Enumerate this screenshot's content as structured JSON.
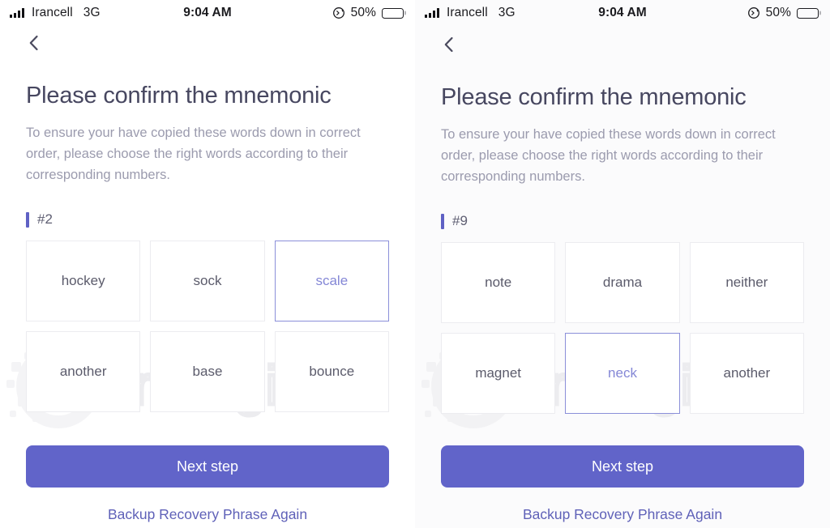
{
  "colors": {
    "accent": "#6164c9",
    "accent_selected_border": "#8b8fd9",
    "accent_selected_text": "#8487d6",
    "title": "#474760",
    "description": "#9b9bae",
    "tile_border": "#ececf0",
    "battery_fill": "#ffcc00",
    "link": "#5f61b8"
  },
  "status_bar": {
    "carrier": "Irancell",
    "network": "3G",
    "time": "9:04 AM",
    "battery_percent": "50%",
    "battery_level": 50,
    "signal_bars": 4,
    "icons": {
      "signal": "signal-bars-icon",
      "orientation_lock": "rotation-lock-icon",
      "battery": "battery-icon"
    }
  },
  "watermark": {
    "text": "ArzDigital"
  },
  "panels": [
    {
      "id": "left",
      "back_icon": "chevron-left-icon",
      "title": "Please confirm the mnemonic",
      "description": "To ensure your have copied these words down in correct order, please choose the right words according to their corresponding numbers.",
      "index_label": "#2",
      "words": [
        {
          "label": "hockey",
          "selected": false
        },
        {
          "label": "sock",
          "selected": false
        },
        {
          "label": "scale",
          "selected": true
        },
        {
          "label": "another",
          "selected": false
        },
        {
          "label": "base",
          "selected": false
        },
        {
          "label": "bounce",
          "selected": false
        }
      ],
      "next_button": "Next step",
      "backup_link": "Backup Recovery Phrase Again"
    },
    {
      "id": "right",
      "back_icon": "chevron-left-icon",
      "title": "Please confirm the mnemonic",
      "description": "To ensure your have copied these words down in correct order, please choose the right words according to their corresponding numbers.",
      "index_label": "#9",
      "words": [
        {
          "label": "note",
          "selected": false
        },
        {
          "label": "drama",
          "selected": false
        },
        {
          "label": "neither",
          "selected": false
        },
        {
          "label": "magnet",
          "selected": false
        },
        {
          "label": "neck",
          "selected": true
        },
        {
          "label": "another",
          "selected": false
        }
      ],
      "next_button": "Next step",
      "backup_link": "Backup Recovery Phrase Again"
    }
  ]
}
